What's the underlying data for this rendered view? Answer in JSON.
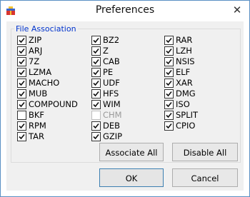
{
  "window": {
    "title": "Preferences",
    "close_glyph": "✕"
  },
  "group": {
    "title": "File Association",
    "col1": [
      {
        "label": "ZIP",
        "checked": true
      },
      {
        "label": "ARJ",
        "checked": true
      },
      {
        "label": "7Z",
        "checked": true
      },
      {
        "label": "LZMA",
        "checked": true
      },
      {
        "label": "MACHO",
        "checked": true
      },
      {
        "label": "MUB",
        "checked": true
      },
      {
        "label": "COMPOUND",
        "checked": true
      },
      {
        "label": "BKF",
        "checked": false
      },
      {
        "label": "RPM",
        "checked": true
      },
      {
        "label": "TAR",
        "checked": true
      }
    ],
    "col2": [
      {
        "label": "BZ2",
        "checked": true
      },
      {
        "label": "Z",
        "checked": true
      },
      {
        "label": "CAB",
        "checked": true
      },
      {
        "label": "PE",
        "checked": true
      },
      {
        "label": "UDF",
        "checked": true
      },
      {
        "label": "HFS",
        "checked": true
      },
      {
        "label": "WIM",
        "checked": true
      },
      {
        "label": "CHM",
        "checked": false,
        "disabled": true
      },
      {
        "label": "DEB",
        "checked": true
      },
      {
        "label": "GZIP",
        "checked": true
      }
    ],
    "col3": [
      {
        "label": "RAR",
        "checked": true
      },
      {
        "label": "LZH",
        "checked": true
      },
      {
        "label": "NSIS",
        "checked": true
      },
      {
        "label": "ELF",
        "checked": true
      },
      {
        "label": "XAR",
        "checked": true
      },
      {
        "label": "DMG",
        "checked": true
      },
      {
        "label": "ISO",
        "checked": true
      },
      {
        "label": "SPLIT",
        "checked": true
      },
      {
        "label": "CPIO",
        "checked": true
      }
    ]
  },
  "buttons": {
    "associate_all": "Associate All",
    "disable_all": "Disable All",
    "ok": "OK",
    "cancel": "Cancel"
  }
}
